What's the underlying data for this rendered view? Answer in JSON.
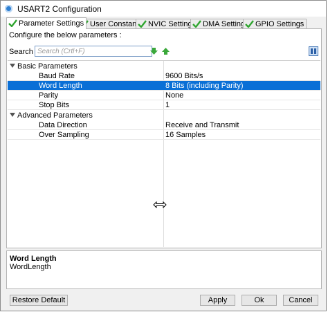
{
  "window": {
    "title": "USART2 Configuration"
  },
  "tabs": [
    {
      "label": "Parameter Settings",
      "active": true
    },
    {
      "label": "User Constants",
      "active": false
    },
    {
      "label": "NVIC Settings",
      "active": false
    },
    {
      "label": "DMA Settings",
      "active": false
    },
    {
      "label": "GPIO Settings",
      "active": false
    }
  ],
  "panel": {
    "subtitle": "Configure the below parameters :",
    "search": {
      "label": "Search :",
      "placeholder": "Search (Crtl+F)"
    }
  },
  "groups": [
    {
      "label": "Basic Parameters",
      "params": [
        {
          "name": "Baud Rate",
          "value": "9600 Bits/s",
          "selected": false
        },
        {
          "name": "Word Length",
          "value": "8 Bits (including Parity)",
          "selected": true
        },
        {
          "name": "Parity",
          "value": "None",
          "selected": false
        },
        {
          "name": "Stop Bits",
          "value": "1",
          "selected": false
        }
      ]
    },
    {
      "label": "Advanced Parameters",
      "params": [
        {
          "name": "Data Direction",
          "value": "Receive and Transmit",
          "selected": false
        },
        {
          "name": "Over Sampling",
          "value": "16 Samples",
          "selected": false
        }
      ]
    }
  ],
  "description": {
    "title": "Word Length",
    "text": "WordLength"
  },
  "buttons": {
    "restore_default": "Restore Default",
    "apply": "Apply",
    "ok": "Ok",
    "cancel": "Cancel"
  },
  "colors": {
    "selection": "#0a6fd6",
    "check_green": "#2fa52f",
    "arrow_green": "#3aa83a"
  },
  "icons": {
    "title": "gear-app-icon",
    "tab_check": "check-icon",
    "search_next": "arrow-down-icon",
    "search_prev": "arrow-up-icon",
    "view_toggle": "grid-view-icon",
    "cursor": "resize-cursor-icon"
  }
}
